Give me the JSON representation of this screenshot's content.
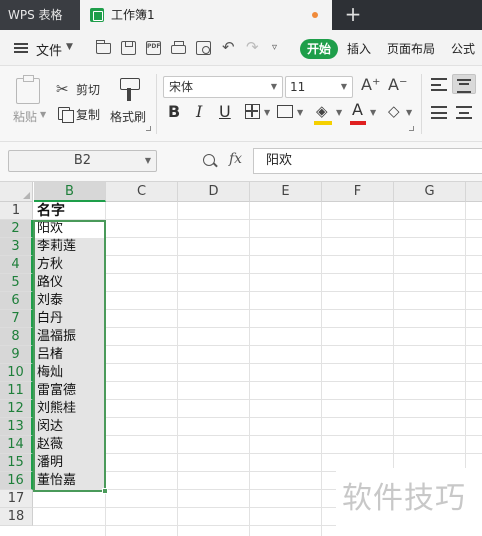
{
  "titlebar": {
    "app_tab": "WPS 表格",
    "doc_tab": "工作簿1",
    "new_tab": "+"
  },
  "menubar": {
    "file_label": "文件",
    "tabs": [
      "开始",
      "插入",
      "页面布局",
      "公式"
    ],
    "active_tab": "开始",
    "quick_access": [
      "open-icon",
      "save-icon",
      "pdf-export-icon",
      "print-icon",
      "print-preview-icon",
      "undo-icon",
      "redo-icon",
      "more-icon"
    ],
    "pdf_glyph": "PDF"
  },
  "ribbon": {
    "paste_label": "粘贴",
    "cut_label": "剪切",
    "copy_label": "复制",
    "format_painter_label": "格式刷",
    "font_name": "宋体",
    "font_size": "11",
    "bold": "B",
    "italic": "I",
    "underline": "U",
    "grow_font": "A⁺",
    "shrink_font": "A⁻",
    "font_color_glyph": "A",
    "font_color": "#e02020",
    "fill_color": "#f5d000"
  },
  "formula_bar": {
    "name_box": "B2",
    "fx": "fx",
    "value": "阳欢"
  },
  "sheet": {
    "columns": [
      "B",
      "C",
      "D",
      "E",
      "F",
      "G"
    ],
    "selected_column": "B",
    "rows": [
      "1",
      "2",
      "3",
      "4",
      "5",
      "6",
      "7",
      "8",
      "9",
      "10",
      "11",
      "12",
      "13",
      "14",
      "15",
      "16",
      "17",
      "18"
    ],
    "cells_b": [
      "名字",
      "阳欢",
      "李莉莲",
      "方秋",
      "路仪",
      "刘泰",
      "白丹",
      "温福振",
      "吕楮",
      "梅灿",
      "雷富德",
      "刘熊桂",
      "闵达",
      "赵薇",
      "潘明",
      "董怡嘉"
    ],
    "active_cell": "B2",
    "selection": "B2:B16",
    "accent_color": "#1e9e4a"
  },
  "watermark": "软件技巧"
}
